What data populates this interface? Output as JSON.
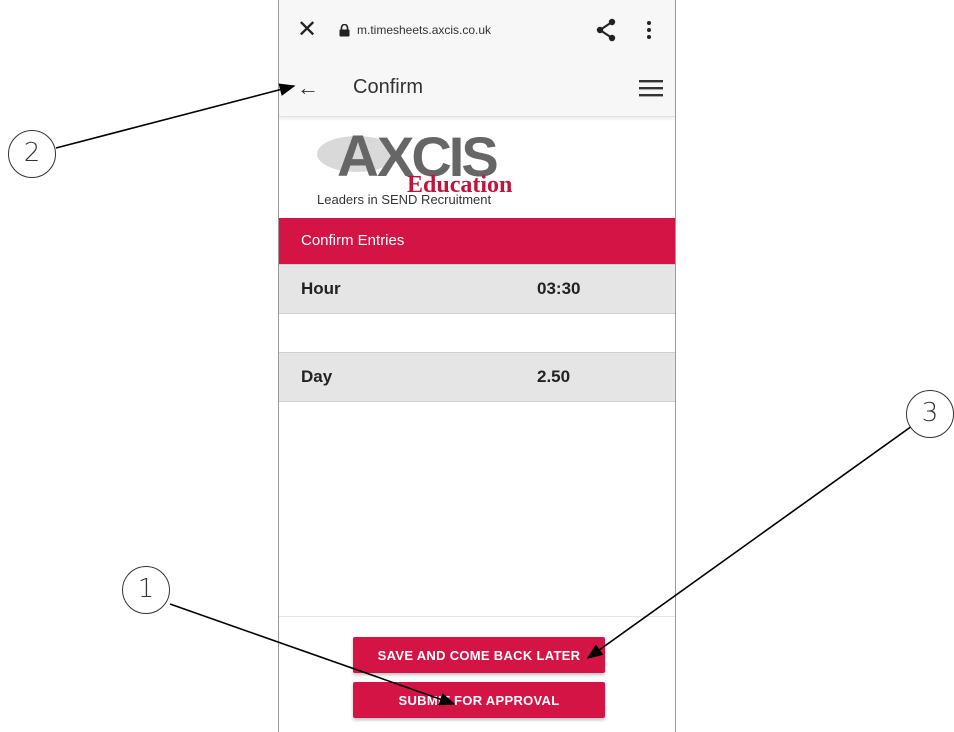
{
  "browser": {
    "url": "m.timesheets.axcis.co.uk",
    "close_icon": "close-icon",
    "lock_icon": "lock-icon",
    "share_icon": "share-icon",
    "more_icon": "more-vertical-icon"
  },
  "app_bar": {
    "title": "Confirm",
    "back_icon": "arrow-back-icon",
    "menu_icon": "hamburger-menu-icon"
  },
  "logo": {
    "brand": "AXCIS",
    "sub": "Education",
    "tagline": "Leaders in SEND Recruitment"
  },
  "section": {
    "title": "Confirm Entries"
  },
  "entries": [
    {
      "label": "Hour",
      "value": "03:30"
    },
    {
      "label": "Day",
      "value": "2.50"
    }
  ],
  "buttons": {
    "save_later": "SAVE AND COME BACK LATER",
    "submit": "SUBMIT FOR APPROVAL"
  },
  "callouts": [
    "1",
    "2",
    "3"
  ],
  "colors": {
    "accent": "#d31445",
    "bar": "#f7f7f7",
    "row": "#e5e5e5"
  }
}
